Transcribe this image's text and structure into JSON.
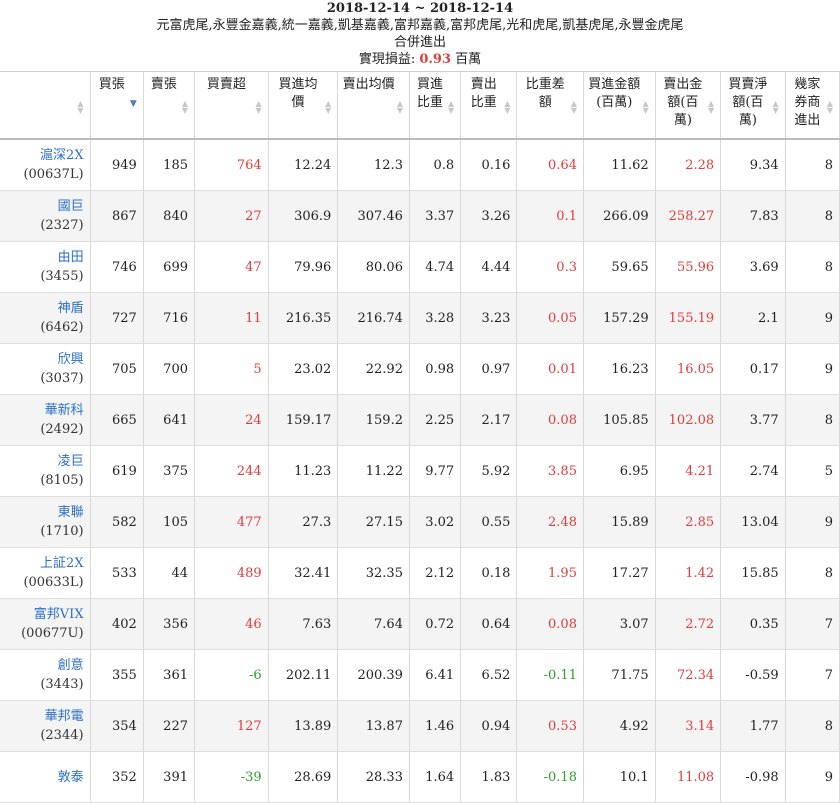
{
  "header": {
    "date_range": "2018-12-14 ~ 2018-12-14",
    "brokers": "元富虎尾,永豐金嘉義,統一嘉義,凱基嘉義,富邦嘉義,富邦虎尾,光和虎尾,凱基虎尾,永豐金虎尾",
    "subtitle": "合併進出",
    "pnl_label": "實現損益:",
    "pnl_value": "0.93",
    "pnl_unit": "百萬"
  },
  "columns": [
    {
      "key": "stock",
      "label": ""
    },
    {
      "key": "buy",
      "label": "買張"
    },
    {
      "key": "sell",
      "label": "賣張"
    },
    {
      "key": "net",
      "label": "買賣超"
    },
    {
      "key": "buy_avg",
      "label": "買進均價"
    },
    {
      "key": "sell_avg",
      "label": "賣出均價"
    },
    {
      "key": "buy_ratio",
      "label": "買進比重"
    },
    {
      "key": "sell_ratio",
      "label": "賣出比重"
    },
    {
      "key": "ratio_diff",
      "label": "比重差額"
    },
    {
      "key": "buy_amt",
      "label": "買進金額(百萬)"
    },
    {
      "key": "sell_amt",
      "label": "賣出金額(百萬)"
    },
    {
      "key": "net_amt",
      "label": "買賣淨額(百萬)"
    },
    {
      "key": "brokers",
      "label": "幾家券商進出"
    }
  ],
  "rows": [
    {
      "name": "滬深2X",
      "code": "(00637L)",
      "buy": "949",
      "sell": "185",
      "net": "764",
      "buy_avg": "12.24",
      "sell_avg": "12.3",
      "buy_ratio": "0.8",
      "sell_ratio": "0.16",
      "ratio_diff": "0.64",
      "buy_amt": "11.62",
      "sell_amt": "2.28",
      "net_amt": "9.34",
      "brokers": "8"
    },
    {
      "name": "國巨",
      "code": "(2327)",
      "buy": "867",
      "sell": "840",
      "net": "27",
      "buy_avg": "306.9",
      "sell_avg": "307.46",
      "buy_ratio": "3.37",
      "sell_ratio": "3.26",
      "ratio_diff": "0.1",
      "buy_amt": "266.09",
      "sell_amt": "258.27",
      "net_amt": "7.83",
      "brokers": "8"
    },
    {
      "name": "由田",
      "code": "(3455)",
      "buy": "746",
      "sell": "699",
      "net": "47",
      "buy_avg": "79.96",
      "sell_avg": "80.06",
      "buy_ratio": "4.74",
      "sell_ratio": "4.44",
      "ratio_diff": "0.3",
      "buy_amt": "59.65",
      "sell_amt": "55.96",
      "net_amt": "3.69",
      "brokers": "8"
    },
    {
      "name": "神盾",
      "code": "(6462)",
      "buy": "727",
      "sell": "716",
      "net": "11",
      "buy_avg": "216.35",
      "sell_avg": "216.74",
      "buy_ratio": "3.28",
      "sell_ratio": "3.23",
      "ratio_diff": "0.05",
      "buy_amt": "157.29",
      "sell_amt": "155.19",
      "net_amt": "2.1",
      "brokers": "9"
    },
    {
      "name": "欣興",
      "code": "(3037)",
      "buy": "705",
      "sell": "700",
      "net": "5",
      "buy_avg": "23.02",
      "sell_avg": "22.92",
      "buy_ratio": "0.98",
      "sell_ratio": "0.97",
      "ratio_diff": "0.01",
      "buy_amt": "16.23",
      "sell_amt": "16.05",
      "net_amt": "0.17",
      "brokers": "9"
    },
    {
      "name": "華新科",
      "code": "(2492)",
      "buy": "665",
      "sell": "641",
      "net": "24",
      "buy_avg": "159.17",
      "sell_avg": "159.2",
      "buy_ratio": "2.25",
      "sell_ratio": "2.17",
      "ratio_diff": "0.08",
      "buy_amt": "105.85",
      "sell_amt": "102.08",
      "net_amt": "3.77",
      "brokers": "8"
    },
    {
      "name": "凌巨",
      "code": "(8105)",
      "buy": "619",
      "sell": "375",
      "net": "244",
      "buy_avg": "11.23",
      "sell_avg": "11.22",
      "buy_ratio": "9.77",
      "sell_ratio": "5.92",
      "ratio_diff": "3.85",
      "buy_amt": "6.95",
      "sell_amt": "4.21",
      "net_amt": "2.74",
      "brokers": "5"
    },
    {
      "name": "東聯",
      "code": "(1710)",
      "buy": "582",
      "sell": "105",
      "net": "477",
      "buy_avg": "27.3",
      "sell_avg": "27.15",
      "buy_ratio": "3.02",
      "sell_ratio": "0.55",
      "ratio_diff": "2.48",
      "buy_amt": "15.89",
      "sell_amt": "2.85",
      "net_amt": "13.04",
      "brokers": "9"
    },
    {
      "name": "上証2X",
      "code": "(00633L)",
      "buy": "533",
      "sell": "44",
      "net": "489",
      "buy_avg": "32.41",
      "sell_avg": "32.35",
      "buy_ratio": "2.12",
      "sell_ratio": "0.18",
      "ratio_diff": "1.95",
      "buy_amt": "17.27",
      "sell_amt": "1.42",
      "net_amt": "15.85",
      "brokers": "8"
    },
    {
      "name": "富邦VIX",
      "code": "(00677U)",
      "buy": "402",
      "sell": "356",
      "net": "46",
      "buy_avg": "7.63",
      "sell_avg": "7.64",
      "buy_ratio": "0.72",
      "sell_ratio": "0.64",
      "ratio_diff": "0.08",
      "buy_amt": "3.07",
      "sell_amt": "2.72",
      "net_amt": "0.35",
      "brokers": "7"
    },
    {
      "name": "創意",
      "code": "(3443)",
      "buy": "355",
      "sell": "361",
      "net": "-6",
      "buy_avg": "202.11",
      "sell_avg": "200.39",
      "buy_ratio": "6.41",
      "sell_ratio": "6.52",
      "ratio_diff": "-0.11",
      "buy_amt": "71.75",
      "sell_amt": "72.34",
      "net_amt": "-0.59",
      "brokers": "7"
    },
    {
      "name": "華邦電",
      "code": "(2344)",
      "buy": "354",
      "sell": "227",
      "net": "127",
      "buy_avg": "13.89",
      "sell_avg": "13.87",
      "buy_ratio": "1.46",
      "sell_ratio": "0.94",
      "ratio_diff": "0.53",
      "buy_amt": "4.92",
      "sell_amt": "3.14",
      "net_amt": "1.77",
      "brokers": "8"
    },
    {
      "name": "敦泰",
      "code": "",
      "buy": "352",
      "sell": "391",
      "net": "-39",
      "buy_avg": "28.69",
      "sell_avg": "28.33",
      "buy_ratio": "1.64",
      "sell_ratio": "1.83",
      "ratio_diff": "-0.18",
      "buy_amt": "10.1",
      "sell_amt": "11.08",
      "net_amt": "-0.98",
      "brokers": "9"
    }
  ],
  "colors": {
    "link": "#2c6fc9",
    "positive": "#e03c3c",
    "negative": "#2e9c2e",
    "sort_active": "#4a7ec8"
  }
}
